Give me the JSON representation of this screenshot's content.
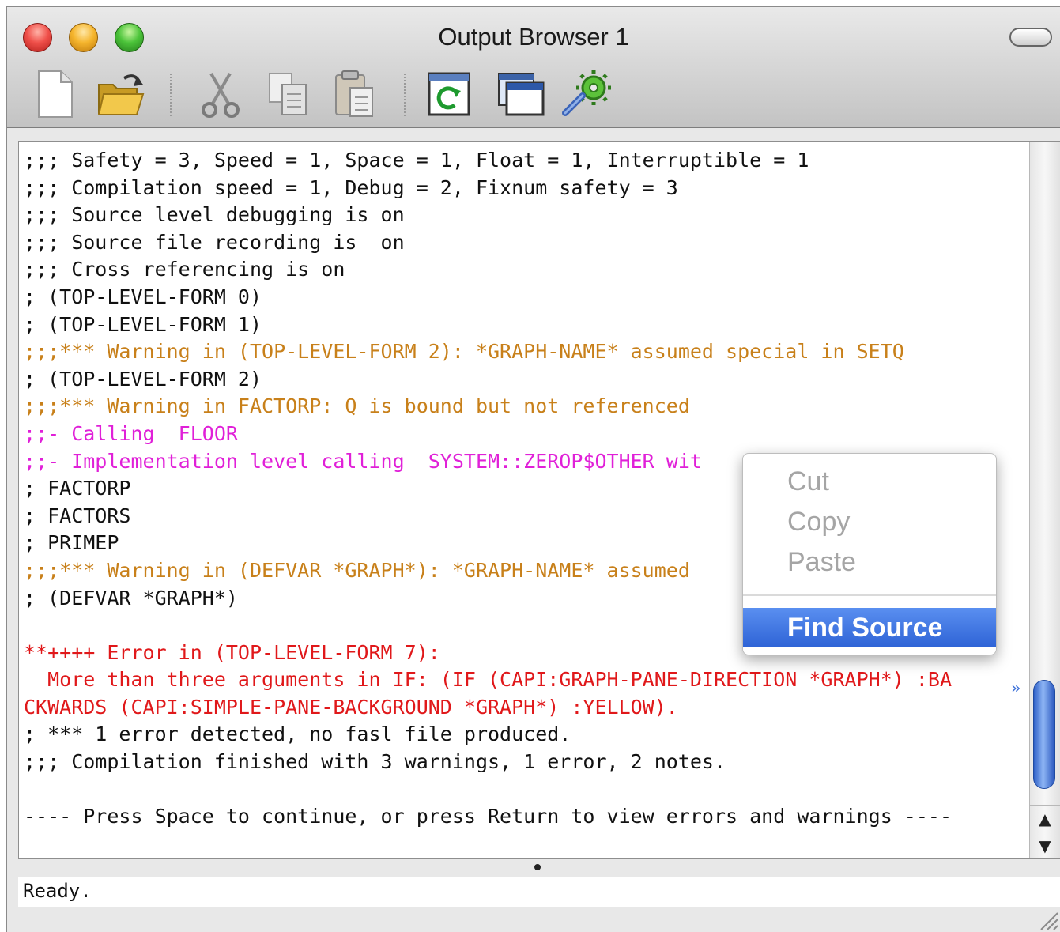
{
  "window": {
    "title": "Output Browser 1"
  },
  "toolbar": {
    "items": [
      {
        "name": "new-document-icon",
        "icon": "new-document-icon"
      },
      {
        "name": "open-folder-icon",
        "icon": "open-folder-icon"
      },
      {
        "name": "cut-icon",
        "icon": "scissors-icon"
      },
      {
        "name": "copy-icon",
        "icon": "copy-icon"
      },
      {
        "name": "paste-icon",
        "icon": "paste-icon"
      },
      {
        "name": "refresh-icon",
        "icon": "refresh-icon"
      },
      {
        "name": "window-icon",
        "icon": "window-icon"
      },
      {
        "name": "tools-icon",
        "icon": "gear-icon"
      }
    ]
  },
  "output": {
    "lines": [
      {
        "text": ";;; Safety = 3, Speed = 1, Space = 1, Float = 1, Interruptible = 1",
        "kind": "plain"
      },
      {
        "text": ";;; Compilation speed = 1, Debug = 2, Fixnum safety = 3",
        "kind": "plain"
      },
      {
        "text": ";;; Source level debugging is on",
        "kind": "plain"
      },
      {
        "text": ";;; Source file recording is  on",
        "kind": "plain"
      },
      {
        "text": ";;; Cross referencing is on",
        "kind": "plain"
      },
      {
        "text": "; (TOP-LEVEL-FORM 0)",
        "kind": "plain"
      },
      {
        "text": "; (TOP-LEVEL-FORM 1)",
        "kind": "plain"
      },
      {
        "text": ";;;*** Warning in (TOP-LEVEL-FORM 2): *GRAPH-NAME* assumed special in SETQ",
        "kind": "warn"
      },
      {
        "text": "; (TOP-LEVEL-FORM 2)",
        "kind": "plain"
      },
      {
        "text": ";;;*** Warning in FACTORP: Q is bound but not referenced",
        "kind": "warn"
      },
      {
        "text": ";;- Calling  FLOOR",
        "kind": "note"
      },
      {
        "text": ";;- Implementation level calling  SYSTEM::ZEROP$OTHER wit",
        "kind": "note"
      },
      {
        "text": "; FACTORP",
        "kind": "plain"
      },
      {
        "text": "; FACTORS",
        "kind": "plain"
      },
      {
        "text": "; PRIMEP",
        "kind": "plain"
      },
      {
        "text": ";;;*** Warning in (DEFVAR *GRAPH*): *GRAPH-NAME* assumed",
        "kind": "warn"
      },
      {
        "text": "; (DEFVAR *GRAPH*)",
        "kind": "plain"
      },
      {
        "text": "",
        "kind": "plain"
      },
      {
        "text": "**++++ Error in (TOP-LEVEL-FORM 7):",
        "kind": "err"
      },
      {
        "text": "  More than three arguments in IF: (IF (CAPI:GRAPH-PANE-DIRECTION *GRAPH*) :BA",
        "kind": "err"
      },
      {
        "text": "CKWARDS (CAPI:SIMPLE-PANE-BACKGROUND *GRAPH*) :YELLOW).",
        "kind": "err"
      },
      {
        "text": "; *** 1 error detected, no fasl file produced.",
        "kind": "plain"
      },
      {
        "text": ";;; Compilation finished with 3 warnings, 1 error, 2 notes.",
        "kind": "plain"
      },
      {
        "text": "",
        "kind": "plain"
      },
      {
        "text": "---- Press Space to continue, or press Return to view errors and warnings ----",
        "kind": "plain"
      }
    ],
    "wrap_marker": "»"
  },
  "context_menu": {
    "items": [
      {
        "label": "Cut",
        "enabled": false
      },
      {
        "label": "Copy",
        "enabled": false
      },
      {
        "label": "Paste",
        "enabled": false
      },
      {
        "label": "Find Source",
        "enabled": true,
        "highlighted": true
      }
    ]
  },
  "status": {
    "text": "Ready."
  },
  "colors": {
    "warning": "#c8801a",
    "note": "#e020d8",
    "error": "#e0181a",
    "menu_highlight": "#3a73e0"
  }
}
